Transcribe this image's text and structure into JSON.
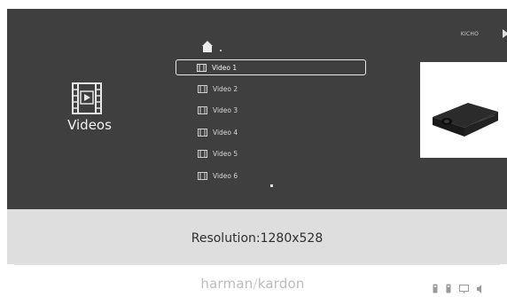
{
  "header": {
    "brand_small": "KICHO"
  },
  "category": {
    "label": "Videos",
    "icon": "film-play-icon"
  },
  "file_list": {
    "up_icon": "home-up-icon",
    "items": [
      {
        "label": "Video 1",
        "selected": true
      },
      {
        "label": "Video 2",
        "selected": false
      },
      {
        "label": "Video 3",
        "selected": false
      },
      {
        "label": "Video 4",
        "selected": false
      },
      {
        "label": "Video 5",
        "selected": false
      },
      {
        "label": "Video 6",
        "selected": false
      }
    ]
  },
  "preview": {
    "subject": "projector"
  },
  "info": {
    "resolution_text": "Resolution:1280x528"
  },
  "footer": {
    "brand": "harman",
    "brand_sep": "/",
    "brand2": "kardon",
    "status_icons": [
      "usb-icon",
      "usb-icon",
      "display-icon",
      "volume-icon"
    ]
  },
  "colors": {
    "screen_bg": "#3f3f3f",
    "info_bg": "#dedede",
    "text_light": "#d8d8d8"
  }
}
